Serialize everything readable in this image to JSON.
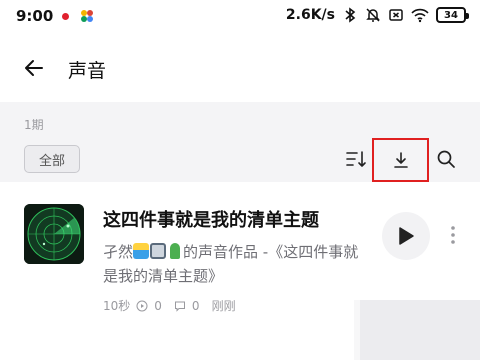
{
  "status_bar": {
    "time": "9:00",
    "network_speed": "2.6K/s",
    "battery_level": "34",
    "icons": [
      "notification-dot-icon",
      "app-icon",
      "bluetooth-icon",
      "bell-muted-icon",
      "sim-off-icon",
      "wifi-icon",
      "battery-icon"
    ]
  },
  "header": {
    "title": "声音",
    "back_icon": "arrow-left-icon"
  },
  "toolbar": {
    "episode_count": "1期",
    "filter_all_label": "全部",
    "icons": [
      "sort-icon",
      "download-icon",
      "search-icon"
    ],
    "highlight_color": "#e02020"
  },
  "items": [
    {
      "title": "这四件事就是我的清单主题",
      "desc_prefix": "孑然",
      "desc_suffix": "的声音作品 -《这四件事就是我的清单主题》",
      "duration": "10秒",
      "plays": "0",
      "comments": "0",
      "time_ago": "刚刚"
    }
  ],
  "colors": {
    "band_bg": "#f4f4f6",
    "muted_text": "#9a9a9f"
  }
}
